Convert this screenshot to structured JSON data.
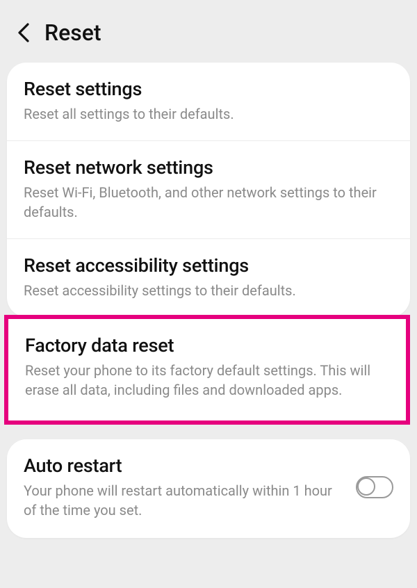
{
  "header": {
    "title": "Reset"
  },
  "items": [
    {
      "title": "Reset settings",
      "desc": "Reset all settings to their defaults."
    },
    {
      "title": "Reset network settings",
      "desc": "Reset Wi-Fi, Bluetooth, and other network settings to their defaults."
    },
    {
      "title": "Reset accessibility settings",
      "desc": "Reset accessibility settings to their defaults."
    },
    {
      "title": "Factory data reset",
      "desc": "Reset your phone to its factory default settings. This will erase all data, including files and downloaded apps."
    }
  ],
  "auto_restart": {
    "title": "Auto restart",
    "desc": "Your phone will restart automatically within 1 hour of the time you set.",
    "enabled": false
  },
  "colors": {
    "highlight": "#e6007e"
  }
}
